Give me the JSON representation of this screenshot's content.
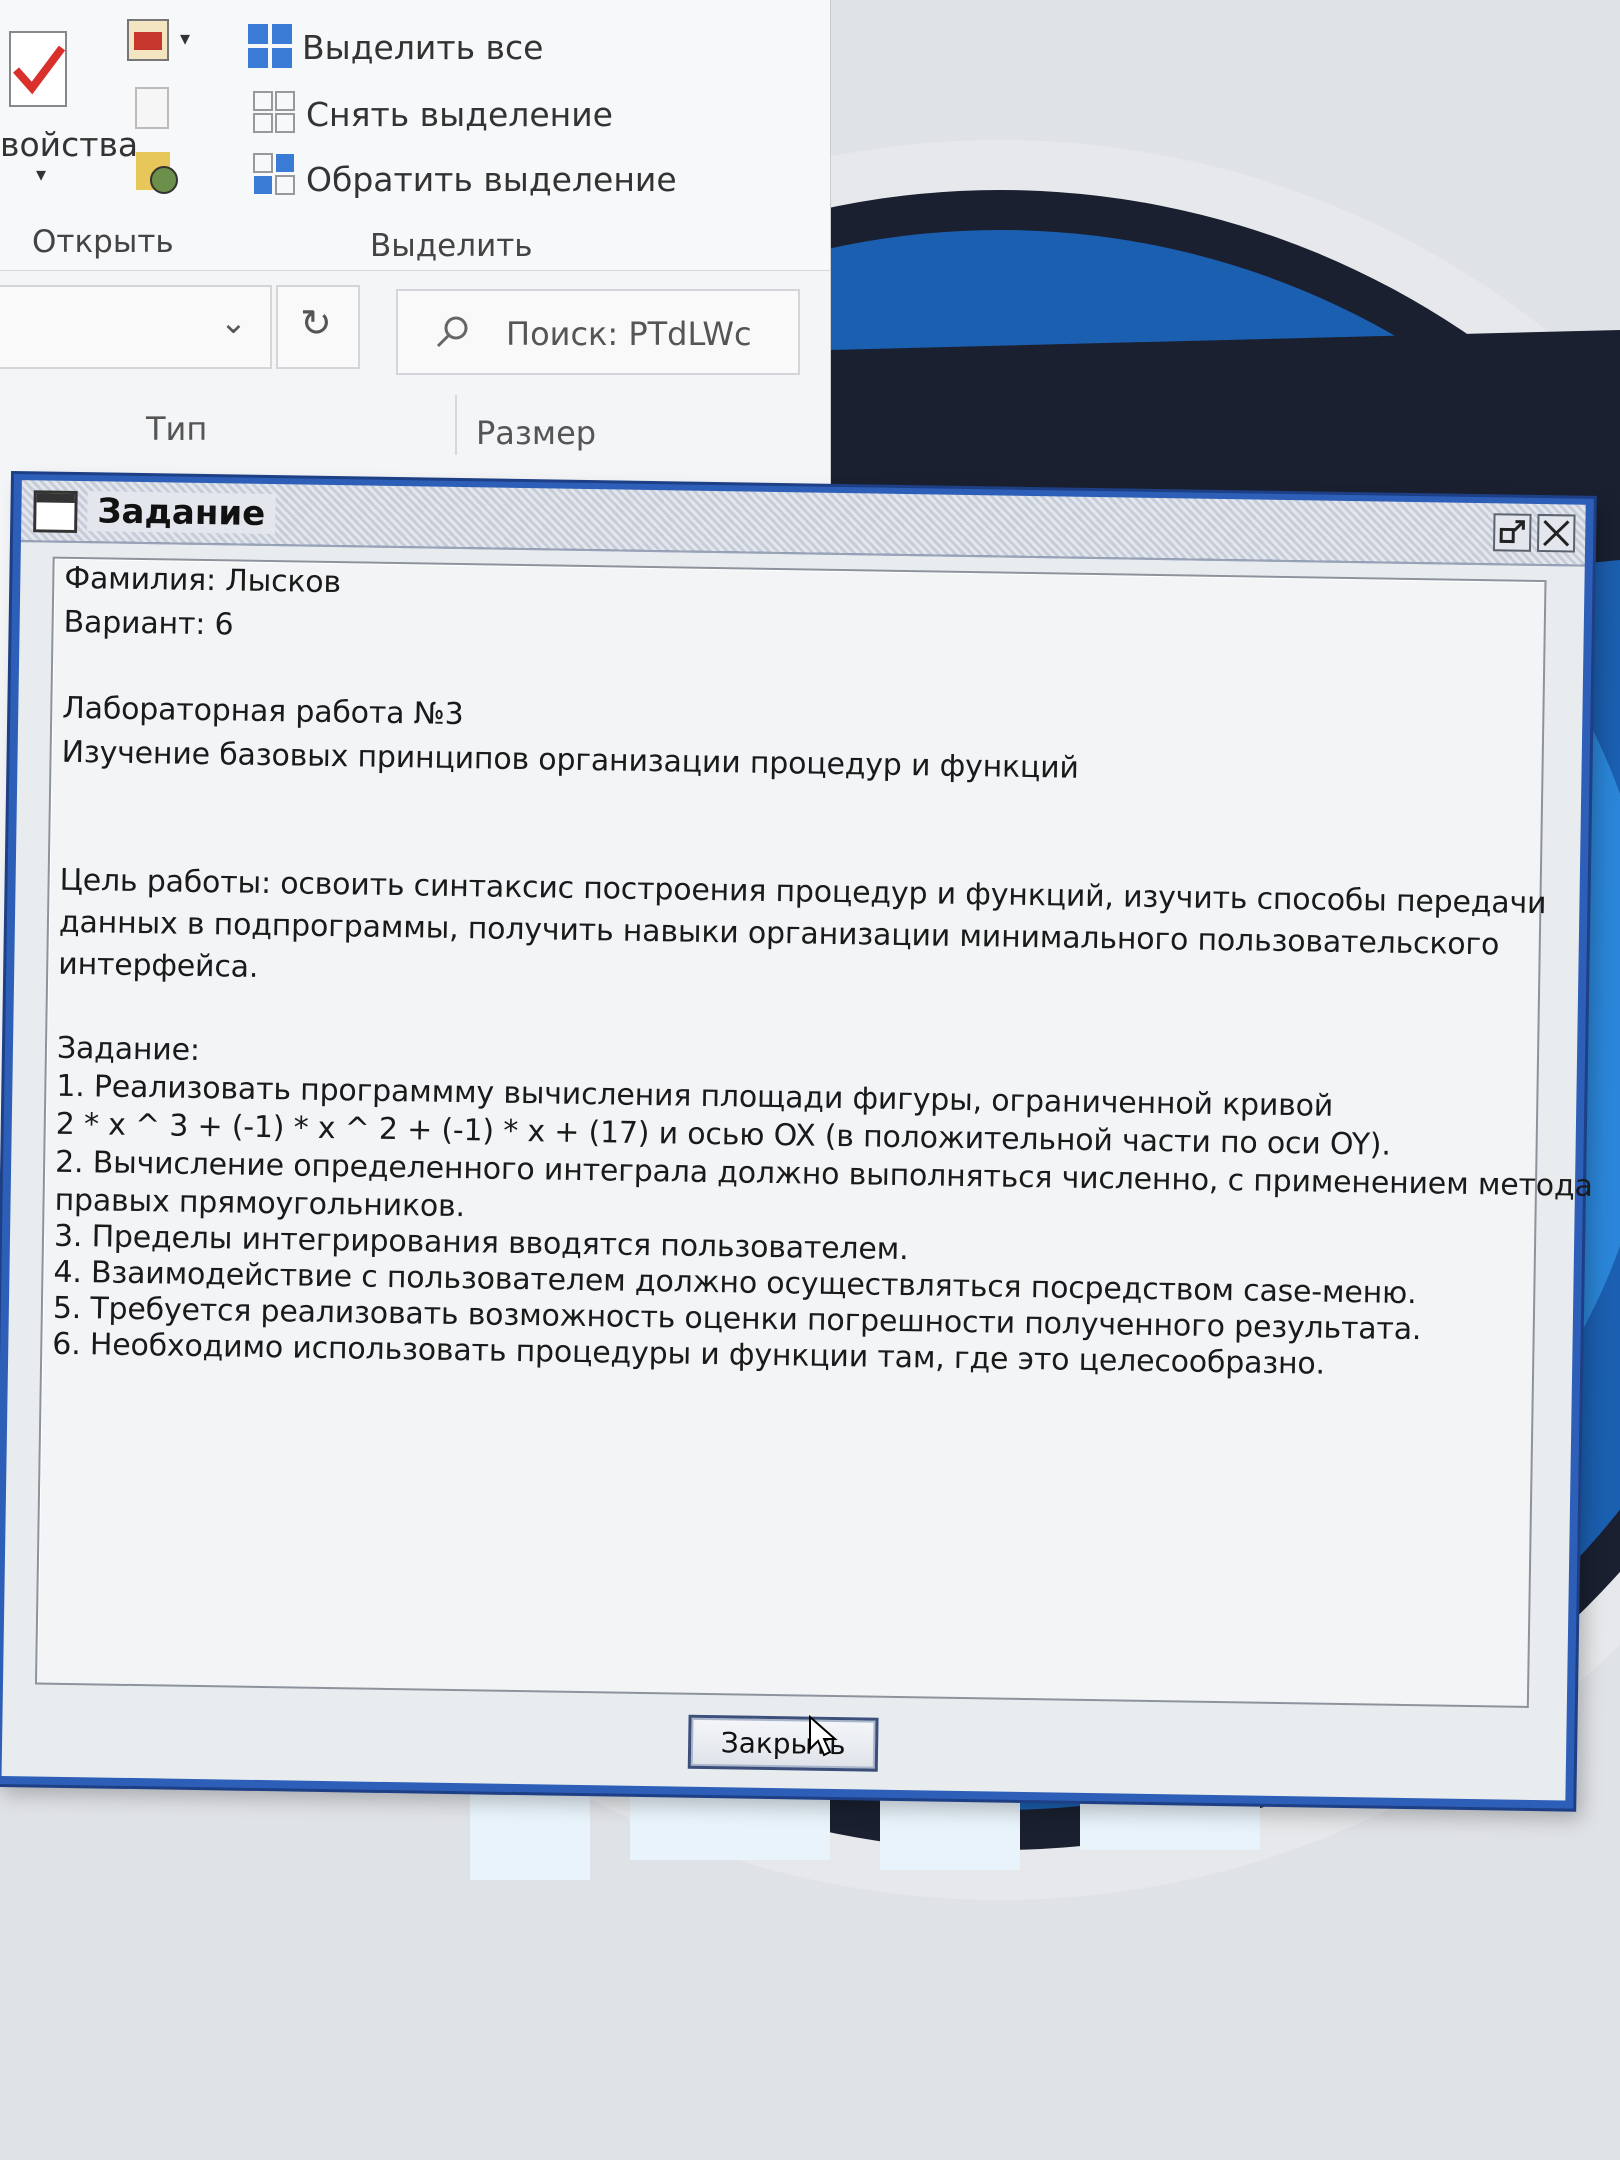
{
  "explorer": {
    "properties_label": "войства",
    "open_group": "Открыть",
    "select_all": "Выделить все",
    "deselect": "Снять выделение",
    "invert_selection": "Обратить выделение",
    "select_group": "Выделить",
    "search_placeholder": "Поиск: PTdLWc",
    "columns": [
      "Тип",
      "Размер"
    ]
  },
  "dialog": {
    "title": "Задание",
    "lines": [
      "Фамилия: Лысков",
      "Вариант: 6",
      "",
      "Лабораторная работа №3",
      "Изучение базовых принципов организации процедур и функций",
      "",
      "",
      "Цель работы: освоить синтаксис построения процедур и функций, изучить способы передачи",
      "данных в подпрограммы, получить навыки организации минимального пользовательского",
      "интерфейса.",
      "",
      "Задание:",
      "1. Реализовать программму вычисления площади фигуры, ограниченной кривой",
      "2 * x ^ 3 + (-1) * x ^ 2 + (-1) * x + (17) и осью OX (в положительной части по оси OY).",
      "2. Вычисление определенного интеграла должно выполняться численно, с применением метода",
      "правых прямоугольников.",
      "3. Пределы интегрирования вводятся пользователем.",
      "4. Взаимодействие с пользователем должно осуществляться посредством case-меню.",
      "5. Требуется реализовать возможность оценки погрешности полученного результата.",
      "6. Необходимо использовать процедуры и функции там, где это целесообразно."
    ],
    "close_label": "Закрыть"
  },
  "colors": {
    "dialog_border": "#2e5fb8",
    "wallpaper_blue": "#1b5fb0",
    "wallpaper_dark": "#1a2030"
  }
}
